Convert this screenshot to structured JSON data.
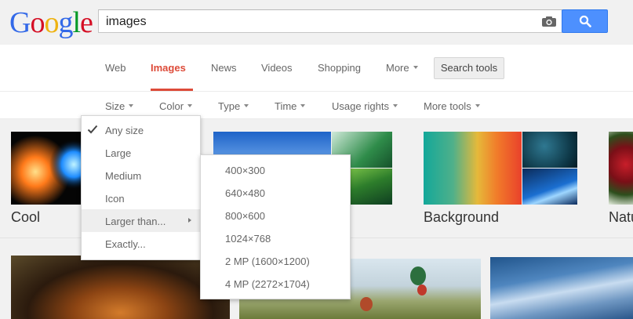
{
  "logo": {
    "letters": [
      "G",
      "o",
      "o",
      "g",
      "l",
      "e"
    ],
    "colors": [
      "#3369e8",
      "#d50f25",
      "#eeb211",
      "#3369e8",
      "#009925",
      "#d50f25"
    ]
  },
  "search": {
    "query": "images",
    "camera_icon": "camera-icon",
    "button_icon": "magnifier-icon"
  },
  "tabs": [
    {
      "label": "Web",
      "active": false
    },
    {
      "label": "Images",
      "active": true
    },
    {
      "label": "News",
      "active": false
    },
    {
      "label": "Videos",
      "active": false
    },
    {
      "label": "Shopping",
      "active": false
    },
    {
      "label": "More",
      "active": false,
      "caret": true
    }
  ],
  "search_tools_label": "Search tools",
  "tools": [
    "Size",
    "Color",
    "Type",
    "Time",
    "Usage rights",
    "More tools"
  ],
  "size_menu": {
    "items": [
      "Any size",
      "Large",
      "Medium",
      "Icon",
      "Larger than...",
      "Exactly..."
    ],
    "checked": "Any size",
    "highlighted": "Larger than..."
  },
  "larger_than_menu": {
    "items": [
      "400×300",
      "640×480",
      "800×600",
      "1024×768",
      "2 MP (1600×1200)",
      "4 MP (2272×1704)"
    ]
  },
  "thumb_labels": {
    "cool": "Cool",
    "background": "Background",
    "nature": "Natu"
  },
  "colors": {
    "accent": "#dd4b39",
    "button_blue": "#4d90fe"
  }
}
